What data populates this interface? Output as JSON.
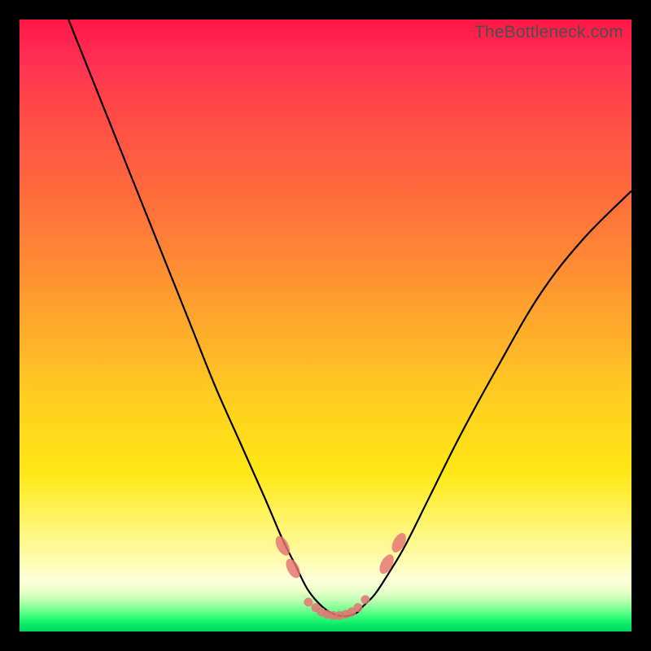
{
  "attribution": "TheBottleneck.com",
  "colors": {
    "background": "#000000",
    "curve": "#000000",
    "marker": "#e57373",
    "gradient_top": "#ff1744",
    "gradient_mid": "#ffd31f",
    "gradient_bottom": "#04d65e"
  },
  "chart_data": {
    "type": "line",
    "title": "",
    "xlabel": "",
    "ylabel": "",
    "xlim": [
      0,
      100
    ],
    "ylim": [
      0,
      100
    ],
    "note": "Curve drawn in a coordinate system where x and y span [0,100] mapped to the 752×752 plot area; y=0 is bottom (green), y=100 is top (red). Values are estimated from pixel positions.",
    "series": [
      {
        "name": "bottleneck-curve",
        "x": [
          8,
          12,
          16,
          20,
          24,
          28,
          32,
          36,
          40,
          43,
          45,
          47,
          49,
          51,
          53,
          55,
          56,
          58,
          60,
          63,
          67,
          72,
          78,
          85,
          92,
          100
        ],
        "y": [
          100,
          90,
          80,
          70,
          60,
          50,
          40,
          31,
          22,
          15,
          11,
          7,
          4.5,
          3,
          2.5,
          3,
          4,
          6,
          9,
          14,
          22,
          32,
          43,
          55,
          64,
          72
        ]
      }
    ],
    "markers": [
      {
        "shape": "lozenge",
        "x": 43.0,
        "y": 14.0
      },
      {
        "shape": "lozenge",
        "x": 44.7,
        "y": 10.3
      },
      {
        "shape": "dot",
        "x": 47.2,
        "y": 4.8
      },
      {
        "shape": "dot",
        "x": 48.4,
        "y": 3.9
      },
      {
        "shape": "dot",
        "x": 49.3,
        "y": 3.2
      },
      {
        "shape": "dot",
        "x": 50.3,
        "y": 2.8
      },
      {
        "shape": "dot",
        "x": 51.3,
        "y": 2.6
      },
      {
        "shape": "dot",
        "x": 52.3,
        "y": 2.6
      },
      {
        "shape": "dot",
        "x": 53.3,
        "y": 2.8
      },
      {
        "shape": "dot",
        "x": 54.3,
        "y": 3.2
      },
      {
        "shape": "dot",
        "x": 55.3,
        "y": 3.9
      },
      {
        "shape": "dot",
        "x": 56.5,
        "y": 5.2
      },
      {
        "shape": "lozenge",
        "x": 60.0,
        "y": 11.0
      },
      {
        "shape": "lozenge",
        "x": 62.0,
        "y": 14.5
      }
    ]
  }
}
